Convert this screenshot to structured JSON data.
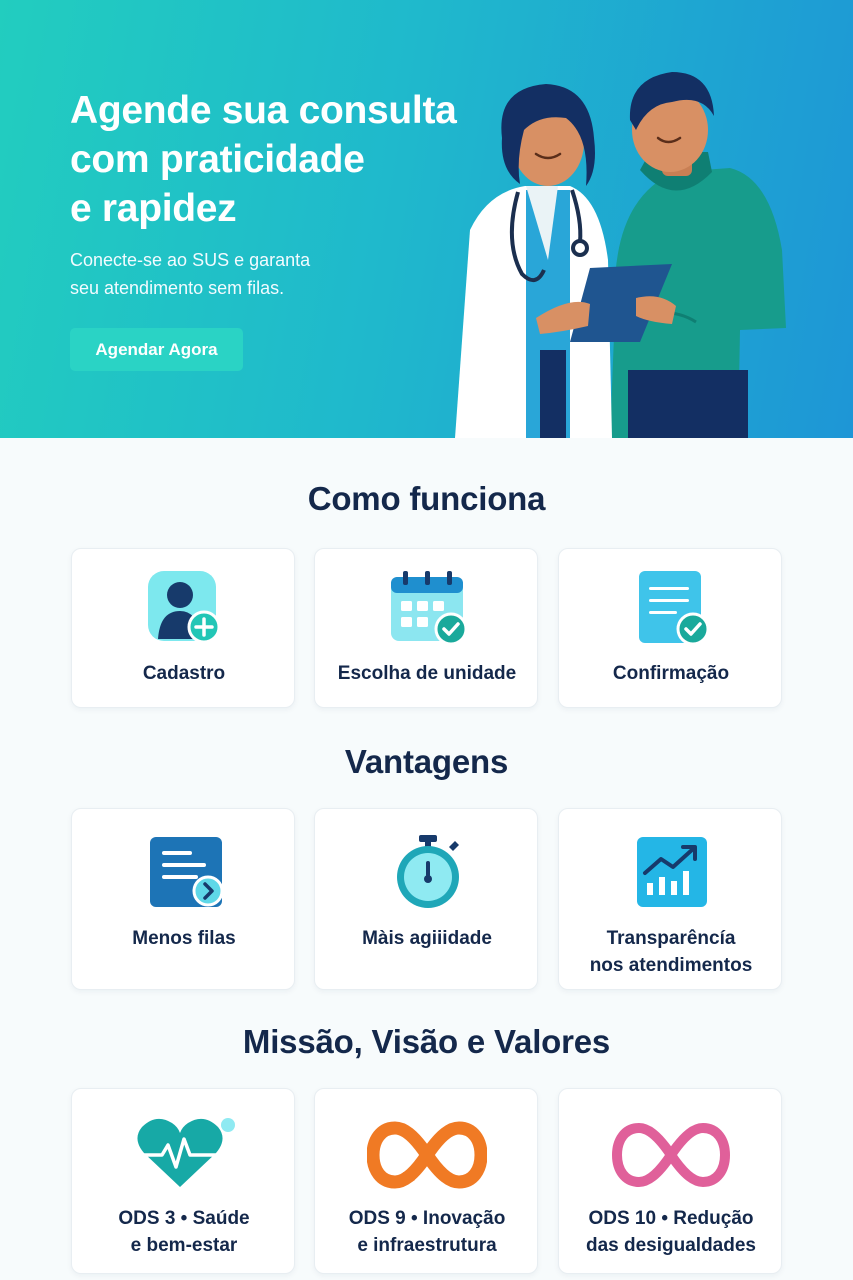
{
  "hero": {
    "title_lines": [
      "Agende sua consulta",
      "com praticidade",
      "e rapidez"
    ],
    "subtitle_lines": [
      "Conecte-se ao SUS e garanta",
      "seu atendimento sem filas."
    ],
    "cta_label": "Agendar Agora",
    "illustration": "doctor-and-patient-illustration"
  },
  "how_it_works": {
    "title": "Como funciona",
    "cards": [
      {
        "label": "Cadastro",
        "icon": "user-add-icon"
      },
      {
        "label": "Escolha de unidade",
        "icon": "calendar-check-icon"
      },
      {
        "label": "Confirmação",
        "icon": "document-check-icon"
      }
    ]
  },
  "advantages": {
    "title": "Vantagens",
    "cards": [
      {
        "label_lines": [
          "Menos filas"
        ],
        "icon": "document-arrow-icon"
      },
      {
        "label_lines": [
          "Màis agiiidade"
        ],
        "icon": "stopwatch-icon"
      },
      {
        "label_lines": [
          "Transparêncía",
          "nos atendimentos"
        ],
        "icon": "growth-chart-icon"
      }
    ]
  },
  "mission": {
    "title": "Missão, Visão e Valores",
    "cards": [
      {
        "label_lines": [
          "ODS 3 • Saúde",
          "e bem-estar"
        ],
        "icon": "heart-pulse-icon"
      },
      {
        "label_lines": [
          "ODS 9 • Inovação",
          "e infraestrutura"
        ],
        "icon": "infinity-orange-icon"
      },
      {
        "label_lines": [
          "ODS 10 • Redução",
          "das desigualdades"
        ],
        "icon": "infinity-pink-icon"
      }
    ]
  },
  "colors": {
    "teal": "#22cdbf",
    "blue": "#1e96d6",
    "navy": "#14284b",
    "orange": "#f07a24",
    "pink": "#e0609a"
  }
}
